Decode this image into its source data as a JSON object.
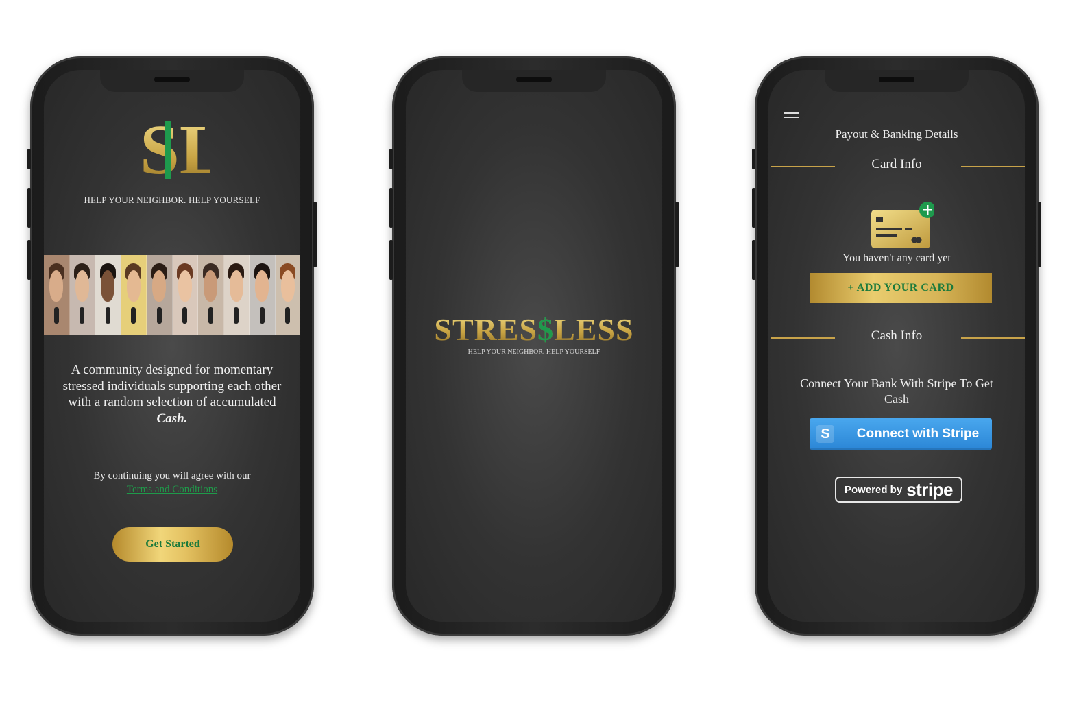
{
  "phone1": {
    "logo_text": "SL",
    "tagline": "HELP YOUR NEIGHBOR. HELP YOURSELF",
    "description_main": "A community designed for momentary stressed individuals supporting each other with a random selection of accumulated ",
    "description_emphasis": "Cash.",
    "agree_text": "By continuing you will agree with our",
    "terms_link": "Terms and Conditions",
    "get_started_label": "Get Started"
  },
  "phone2": {
    "brand_part1": "STRES",
    "brand_dollar": "$",
    "brand_part2": "LESS",
    "brand_tagline": "HELP YOUR NEIGHBOR. HELP YOURSELF"
  },
  "phone3": {
    "title": "Payout & Banking Details",
    "card_section": "Card Info",
    "no_card_text": "You haven't any card yet",
    "add_card_label": "+ ADD YOUR CARD",
    "cash_section": "Cash Info",
    "connect_text": "Connect Your Bank With Stripe To Get Cash",
    "stripe_button_mark": "S",
    "stripe_button_label": "Connect with Stripe",
    "powered_by": "Powered by",
    "stripe_word": "stripe"
  },
  "colors": {
    "gold": "#d4b254",
    "green": "#1e9a4d",
    "stripe_blue": "#3b97e3"
  }
}
